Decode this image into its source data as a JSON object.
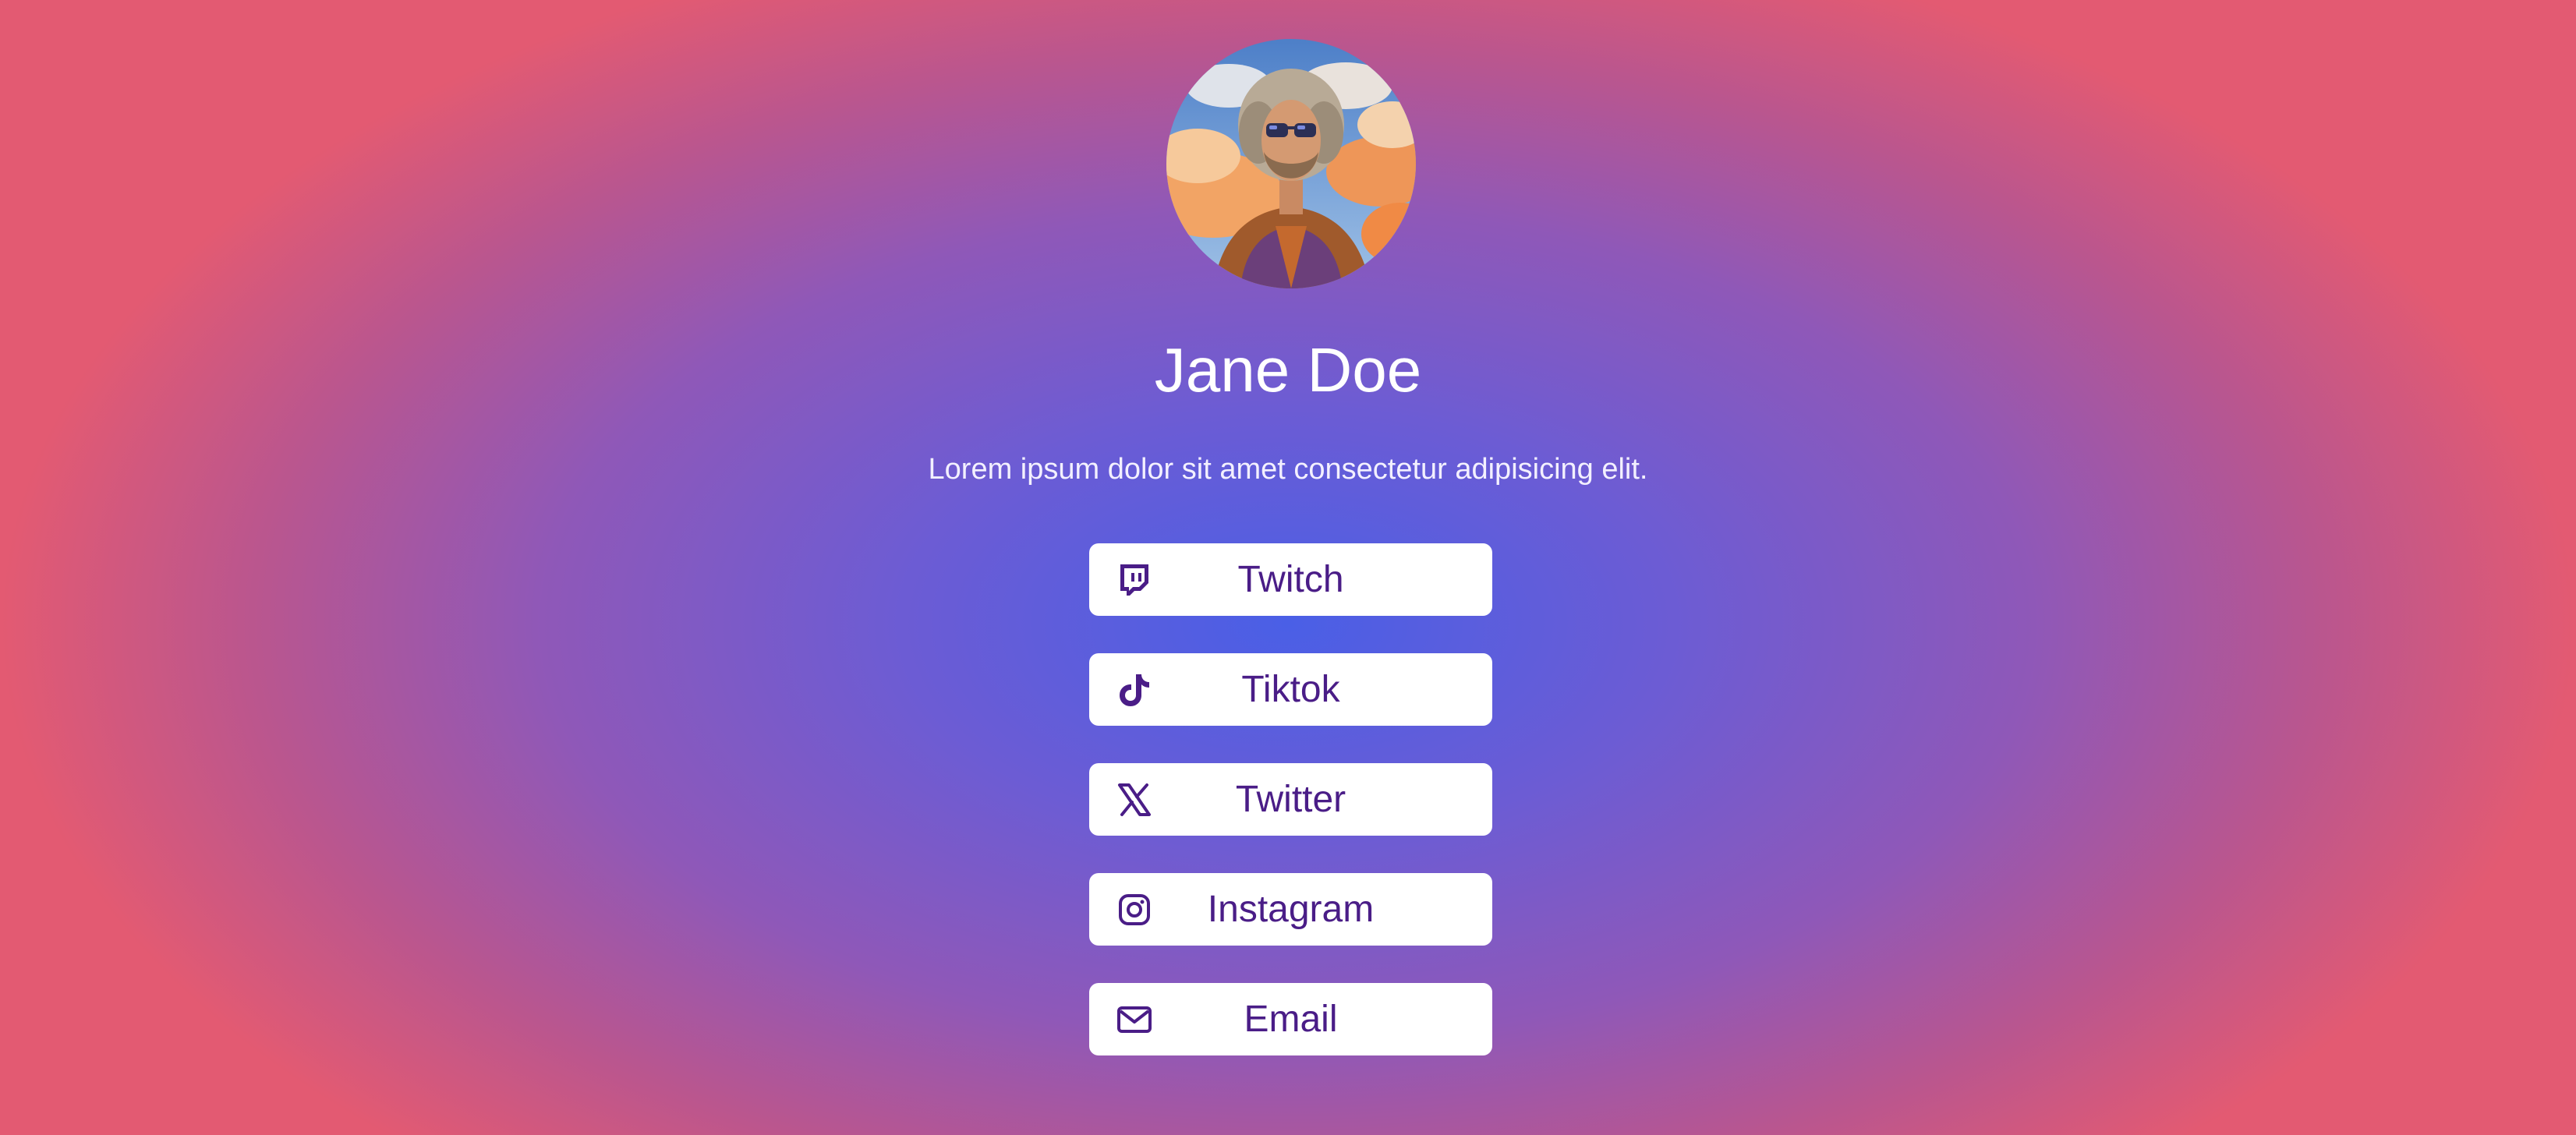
{
  "profile": {
    "name": "Jane Doe",
    "bio": "Lorem ipsum dolor sit amet consectetur adipisicing elit."
  },
  "links": [
    {
      "label": "Twitch",
      "icon": "twitch-icon"
    },
    {
      "label": "Tiktok",
      "icon": "tiktok-icon"
    },
    {
      "label": "Twitter",
      "icon": "x-twitter-icon"
    },
    {
      "label": "Instagram",
      "icon": "instagram-icon"
    },
    {
      "label": "Email",
      "icon": "envelope-icon"
    }
  ],
  "colors": {
    "button_text": "#4a1d87",
    "button_bg": "#ffffff",
    "gradient_center": "#4a5fe6",
    "gradient_edge": "#e35a72"
  }
}
